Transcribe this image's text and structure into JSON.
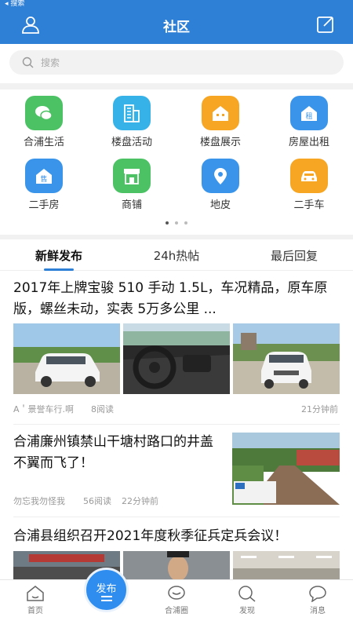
{
  "status": {
    "back_label": "◂ 搜索"
  },
  "header": {
    "title": "社区",
    "left_icon": "user-icon",
    "right_icon": "edit-icon"
  },
  "search": {
    "placeholder": "搜索"
  },
  "grid": {
    "items": [
      {
        "label": "合浦生活",
        "icon": "chat-bubble-icon",
        "color": "#4cc265"
      },
      {
        "label": "楼盘活动",
        "icon": "building-icon",
        "color": "#36b2e8"
      },
      {
        "label": "楼盘展示",
        "icon": "house-icon",
        "color": "#f6a623"
      },
      {
        "label": "房屋出租",
        "icon": "rent-icon",
        "color": "#3a95ea"
      },
      {
        "label": "二手房",
        "icon": "sale-icon",
        "color": "#3a95ea"
      },
      {
        "label": "商铺",
        "icon": "shop-icon",
        "color": "#4cc265"
      },
      {
        "label": "地皮",
        "icon": "location-pin-icon",
        "color": "#3a95ea"
      },
      {
        "label": "二手车",
        "icon": "car-icon",
        "color": "#f6a623"
      }
    ],
    "page_count": 3,
    "active_page": 1
  },
  "tabs": [
    {
      "label": "新鲜发布",
      "active": true
    },
    {
      "label": "24h热帖",
      "active": false
    },
    {
      "label": "最后回复",
      "active": false
    }
  ],
  "feed": {
    "posts": [
      {
        "title": "2017年上牌宝骏 510 手动 1.5L，车况精品，原车原版，螺丝未动，实表 5万多公里 ...",
        "author": "A＇景誉车行.啊",
        "views": "8阅读",
        "time": "21分钟前"
      },
      {
        "title": "合浦廉州镇禁山干塘村路口的井盖不翼而飞了！",
        "author": "勿忘我勿怪我",
        "views": "56阅读",
        "time": "22分钟前"
      },
      {
        "title": "合浦县组织召开2021年度秋季征兵定兵会议！"
      }
    ]
  },
  "bottom_nav": {
    "items": [
      {
        "label": "首页",
        "icon": "home-icon"
      },
      {
        "label": "合浦圈",
        "icon": "circle-chat-icon"
      },
      {
        "label": "发现",
        "icon": "search-icon"
      },
      {
        "label": "消息",
        "icon": "message-icon"
      }
    ],
    "publish_label": "发布"
  },
  "colors": {
    "brand": "#2e7fd6",
    "fab": "#2f8df0"
  }
}
